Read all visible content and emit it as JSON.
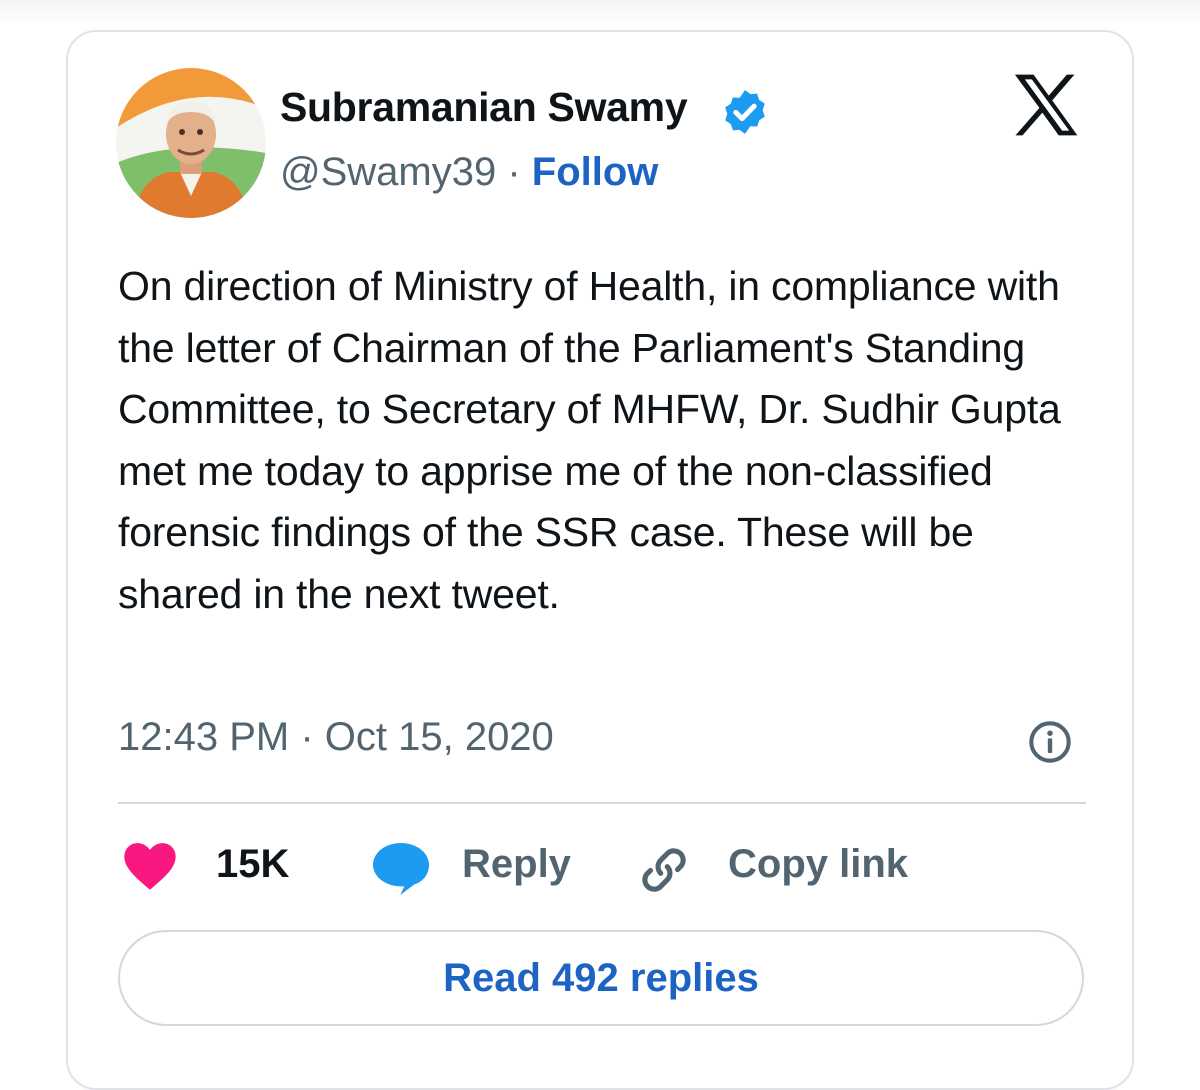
{
  "author": {
    "display_name": "Subramanian Swamy",
    "handle": "@Swamy39",
    "separator": " · ",
    "follow_label": "Follow",
    "verified": true
  },
  "tweet": {
    "text": "On direction of Ministry of Health, in compliance with the letter of Chairman of the Parliament's Standing Committee, to Secretary of MHFW, Dr. Sudhir Gupta met me today to apprise me of the non-classified forensic findings of the SSR case. These will be shared in the next tweet.",
    "timestamp": "12:43 PM · Oct 15, 2020"
  },
  "actions": {
    "like_count": "15K",
    "reply_label": "Reply",
    "copy_link_label": "Copy link"
  },
  "read_replies_label": "Read 492 replies",
  "colors": {
    "accent_blue": "#1d63c4",
    "verified_blue": "#1d9bf0",
    "like_pink": "#f91880",
    "reply_blue": "#1d9bf0",
    "text_primary": "#0f1419",
    "text_secondary": "#536471",
    "border": "#cfd9de"
  },
  "icons": {
    "brand": "x-logo-icon",
    "verified": "verified-badge-icon",
    "info": "info-icon",
    "like": "heart-icon",
    "reply": "speech-bubble-icon",
    "copy_link": "link-icon"
  }
}
